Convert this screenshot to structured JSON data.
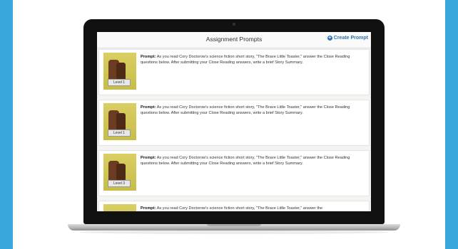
{
  "screen": {
    "title": "Assignment Prompts",
    "create_button_label": "Create Prompt",
    "create_icon": "plus-circle-icon",
    "accent_color": "#2a74b8"
  },
  "prompts": [
    {
      "level": "Level 1",
      "prompt_label": "Prompt:",
      "prompt_text": "As you read Cory Doctorow's science fiction short story, \"The Brave Little Toaster,\" answer the Close Reading questions below. After submitting your Close Reading answers, write a brief Story Summary."
    },
    {
      "level": "Level 1",
      "prompt_label": "Prompt:",
      "prompt_text": "As you read Cory Doctorow's science fiction short story, \"The Brave Little Toaster,\" answer the Close Reading questions below. After submitting your Close Reading answers, write a brief Story Summary."
    },
    {
      "level": "Level 3",
      "prompt_label": "Prompt:",
      "prompt_text": "As you read Cory Doctorow's science fiction short story, \"The Brave Little Toaster,\" answer the Close Reading questions below. After submitting your Close Reading answers, write a brief Story Summary."
    },
    {
      "level": "",
      "prompt_label": "Prompt:",
      "prompt_text": "As you read Cory Doctorow's science fiction short story, \"The Brave Little Toaster,\" answer the"
    }
  ],
  "colors": {
    "background": "#3aa8dc",
    "card": "#ffffff"
  }
}
